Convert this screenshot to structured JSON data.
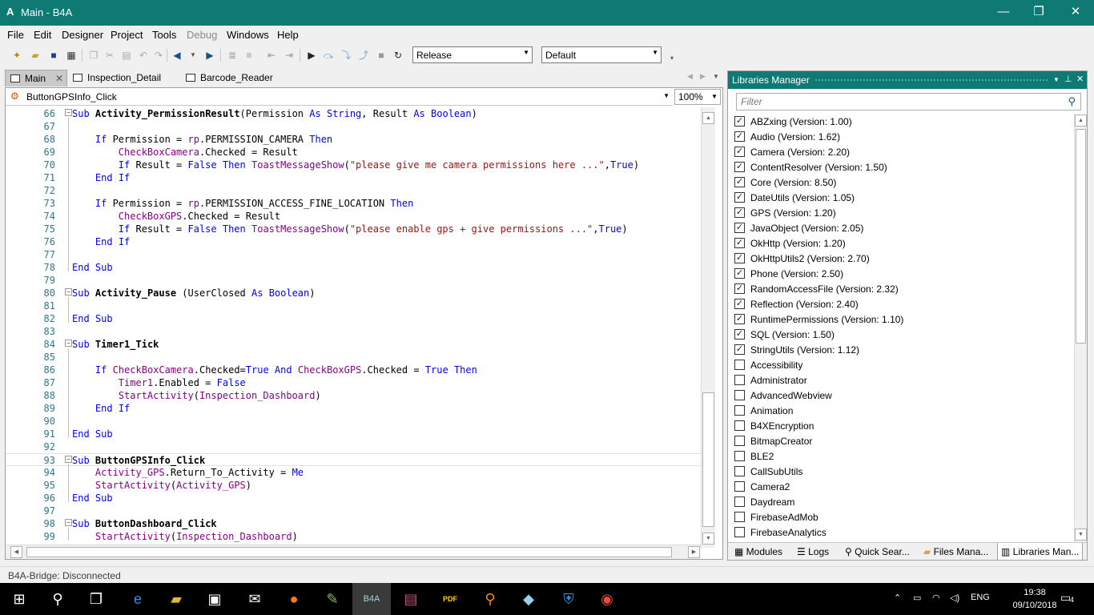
{
  "window": {
    "title": "Main - B4A",
    "logo": "A",
    "minimize": "—",
    "restore": "❐",
    "close": "✕"
  },
  "menu": [
    "File",
    "Edit",
    "Designer",
    "Project",
    "Tools",
    "Debug",
    "Windows",
    "Help"
  ],
  "toolbar": {
    "build_config": "Release",
    "device": "Default"
  },
  "doc_tabs": [
    "Main",
    "Inspection_Detail",
    "Barcode_Reader"
  ],
  "editor": {
    "sub_selector": "ButtonGPSInfo_Click",
    "zoom": "100%",
    "lines": [
      {
        "n": "66",
        "t": "Sub Activity_PermissionResult(Permission As String, Result As Boolean)"
      },
      {
        "n": "67",
        "t": ""
      },
      {
        "n": "68",
        "t": "    If Permission = rp.PERMISSION_CAMERA Then"
      },
      {
        "n": "69",
        "t": "        CheckBoxCamera.Checked = Result"
      },
      {
        "n": "70",
        "t": "        If Result = False Then ToastMessageShow(\"please give me camera permissions here ...\",True)"
      },
      {
        "n": "71",
        "t": "    End If"
      },
      {
        "n": "72",
        "t": ""
      },
      {
        "n": "73",
        "t": "    If Permission = rp.PERMISSION_ACCESS_FINE_LOCATION Then"
      },
      {
        "n": "74",
        "t": "        CheckBoxGPS.Checked = Result"
      },
      {
        "n": "75",
        "t": "        If Result = False Then ToastMessageShow(\"please enable gps + give permissions ...\",True)"
      },
      {
        "n": "76",
        "t": "    End If"
      },
      {
        "n": "77",
        "t": ""
      },
      {
        "n": "78",
        "t": "End Sub"
      },
      {
        "n": "79",
        "t": ""
      },
      {
        "n": "80",
        "t": "Sub Activity_Pause (UserClosed As Boolean)"
      },
      {
        "n": "81",
        "t": ""
      },
      {
        "n": "82",
        "t": "End Sub"
      },
      {
        "n": "83",
        "t": ""
      },
      {
        "n": "84",
        "t": "Sub Timer1_Tick"
      },
      {
        "n": "85",
        "t": ""
      },
      {
        "n": "86",
        "t": "    If CheckBoxCamera.Checked=True And CheckBoxGPS.Checked = True Then"
      },
      {
        "n": "87",
        "t": "        Timer1.Enabled = False"
      },
      {
        "n": "88",
        "t": "        StartActivity(Inspection_Dashboard)"
      },
      {
        "n": "89",
        "t": "    End If"
      },
      {
        "n": "90",
        "t": ""
      },
      {
        "n": "91",
        "t": "End Sub"
      },
      {
        "n": "92",
        "t": ""
      },
      {
        "n": "93",
        "t": "Sub ButtonGPSInfo_Click"
      },
      {
        "n": "94",
        "t": "    Activity_GPS.Return_To_Activity = Me"
      },
      {
        "n": "95",
        "t": "    StartActivity(Activity_GPS)"
      },
      {
        "n": "96",
        "t": "End Sub"
      },
      {
        "n": "97",
        "t": ""
      },
      {
        "n": "98",
        "t": "Sub ButtonDashboard_Click"
      },
      {
        "n": "99",
        "t": "    StartActivity(Inspection_Dashboard)"
      }
    ]
  },
  "libraries": {
    "title": "Libraries Manager",
    "filter_placeholder": "Filter",
    "items": [
      {
        "name": "ABZxing (Version: 1.00)",
        "checked": true
      },
      {
        "name": "Audio (Version: 1.62)",
        "checked": true
      },
      {
        "name": "Camera (Version: 2.20)",
        "checked": true
      },
      {
        "name": "ContentResolver (Version: 1.50)",
        "checked": true
      },
      {
        "name": "Core (Version: 8.50)",
        "checked": true
      },
      {
        "name": "DateUtils (Version: 1.05)",
        "checked": true
      },
      {
        "name": "GPS (Version: 1.20)",
        "checked": true
      },
      {
        "name": "JavaObject (Version: 2.05)",
        "checked": true
      },
      {
        "name": "OkHttp (Version: 1.20)",
        "checked": true
      },
      {
        "name": "OkHttpUtils2 (Version: 2.70)",
        "checked": true
      },
      {
        "name": "Phone (Version: 2.50)",
        "checked": true
      },
      {
        "name": "RandomAccessFile (Version: 2.32)",
        "checked": true
      },
      {
        "name": "Reflection (Version: 2.40)",
        "checked": true
      },
      {
        "name": "RuntimePermissions (Version: 1.10)",
        "checked": true
      },
      {
        "name": "SQL (Version: 1.50)",
        "checked": true
      },
      {
        "name": "StringUtils (Version: 1.12)",
        "checked": true
      },
      {
        "name": "Accessibility",
        "checked": false
      },
      {
        "name": "Administrator",
        "checked": false
      },
      {
        "name": "AdvancedWebview",
        "checked": false
      },
      {
        "name": "Animation",
        "checked": false
      },
      {
        "name": "B4XEncryption",
        "checked": false
      },
      {
        "name": "BitmapCreator",
        "checked": false
      },
      {
        "name": "BLE2",
        "checked": false
      },
      {
        "name": "CallSubUtils",
        "checked": false
      },
      {
        "name": "Camera2",
        "checked": false
      },
      {
        "name": "Daydream",
        "checked": false
      },
      {
        "name": "FirebaseAdMob",
        "checked": false
      },
      {
        "name": "FirebaseAnalytics",
        "checked": false
      }
    ],
    "tabs": [
      "Modules",
      "Logs",
      "Quick Sear...",
      "Files Mana...",
      "Libraries Man..."
    ]
  },
  "status": "B4A-Bridge: Disconnected",
  "taskbar": {
    "apps": [
      "start-icon",
      "search-icon",
      "task-view-icon",
      "edge-icon",
      "file-explorer-icon",
      "store-icon",
      "mail-icon",
      "firefox-icon",
      "notepad-icon",
      "b4a-icon",
      "winrar-icon",
      "pdf-icon",
      "search-tool-icon",
      "app-icon",
      "defender-icon",
      "chrome-icon"
    ],
    "b4a_label": "B4A",
    "pdf_label": "PDF",
    "language": "ENG",
    "time": "19:38",
    "date": "09/10/2018",
    "notifications": "4"
  }
}
